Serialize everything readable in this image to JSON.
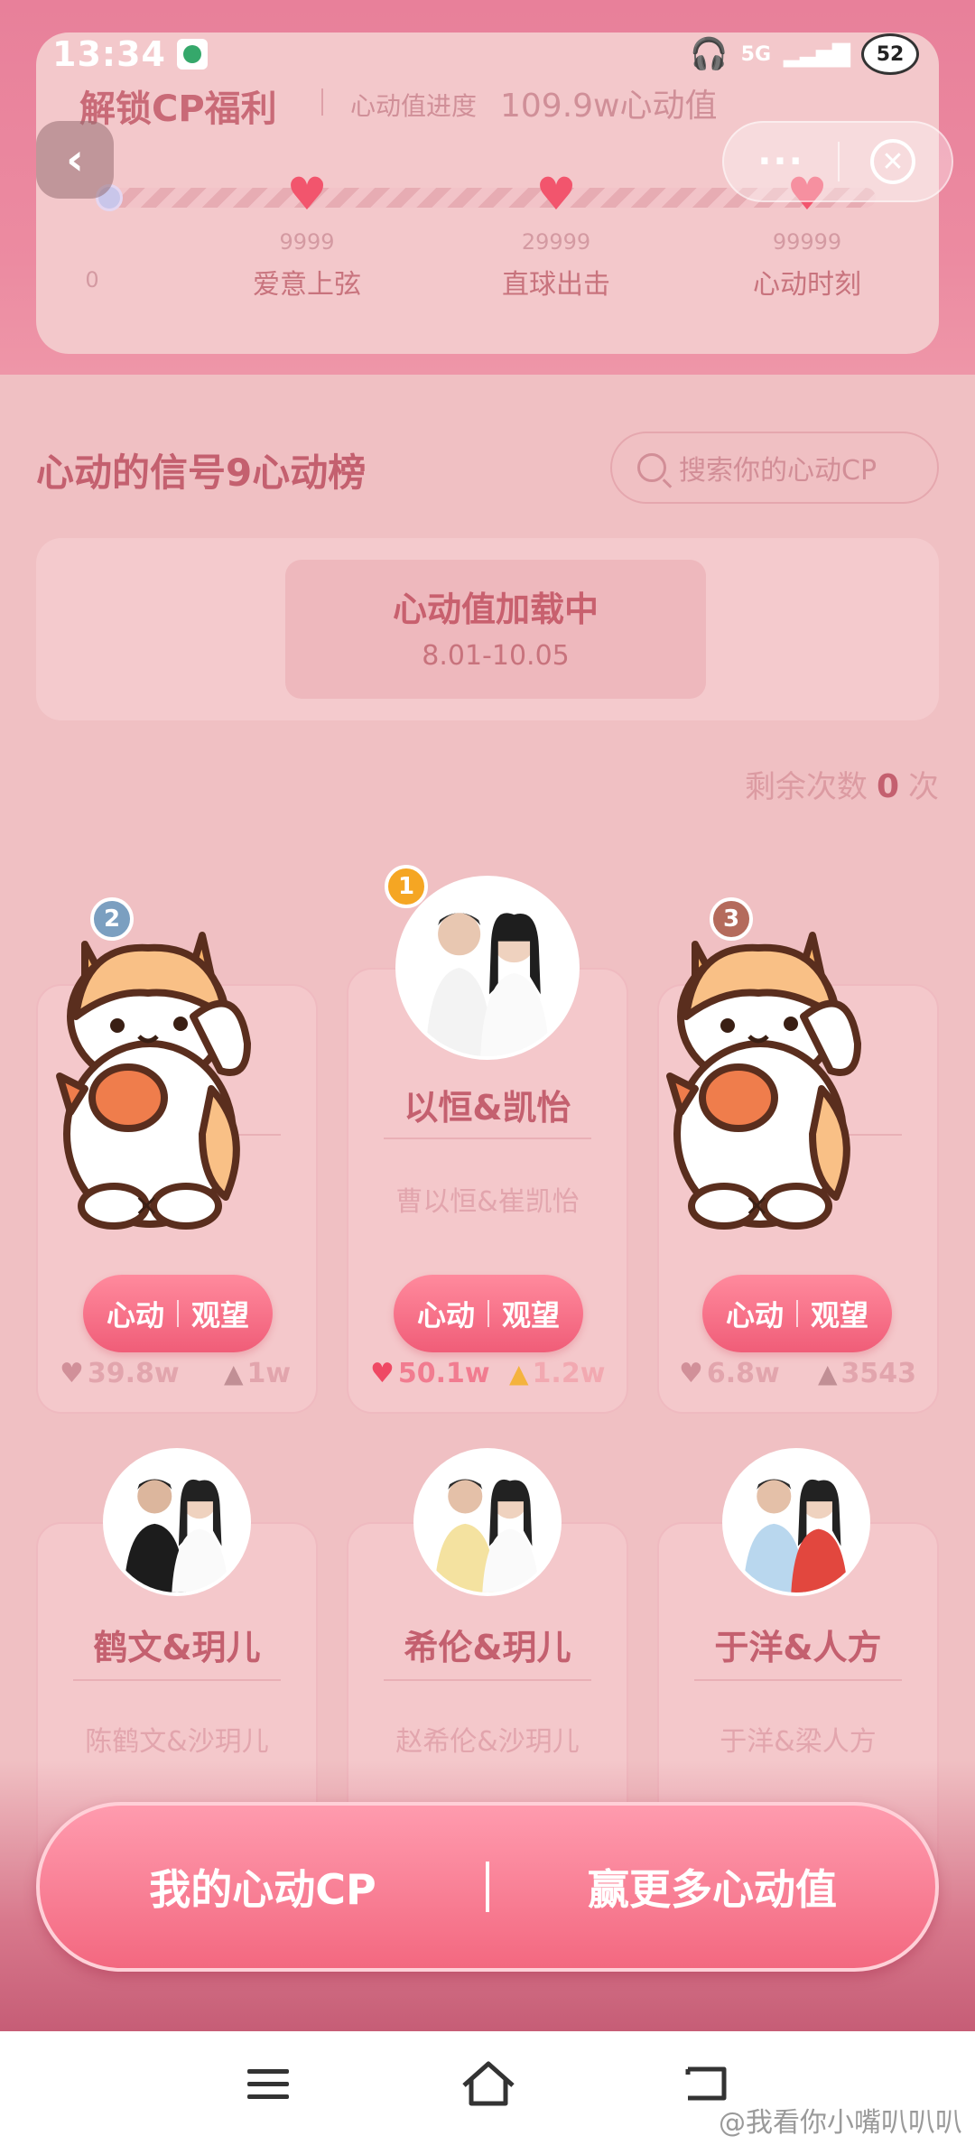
{
  "status_bar": {
    "time": "13:34",
    "network": "5G",
    "battery": "52"
  },
  "welfare": {
    "title": "解锁CP福利",
    "progress_label": "心动值进度",
    "progress_value": "109.9w心动值",
    "milestones": [
      {
        "value": "0",
        "name": ""
      },
      {
        "value": "9999",
        "name": "爱意上弦"
      },
      {
        "value": "29999",
        "name": "直球出击"
      },
      {
        "value": "99999",
        "name": "心动时刻"
      }
    ]
  },
  "nav": {
    "back_icon": "chevron-left-icon",
    "more_label": "···",
    "close_icon": "close-icon"
  },
  "ranking": {
    "title": "心动的信号9心动榜",
    "search_placeholder": "搜索你的心动CP",
    "loading_title": "心动值加载中",
    "loading_date": "8.01-10.05",
    "remaining_prefix": "剩余次数",
    "remaining_count": "0",
    "remaining_suffix": "次"
  },
  "cards": [
    {
      "rank": "2",
      "name": "",
      "sub": "",
      "action_a": "心动",
      "action_b": "观望",
      "likes": "39.8w",
      "heat": "1w",
      "covered": true
    },
    {
      "rank": "1",
      "name": "以恒&凯怡",
      "sub": "曹以恒&崔凯怡",
      "action_a": "心动",
      "action_b": "观望",
      "likes": "50.1w",
      "heat": "1.2w",
      "covered": false
    },
    {
      "rank": "3",
      "name": "",
      "sub": "",
      "action_a": "心动",
      "action_b": "观望",
      "likes": "6.8w",
      "heat": "3543",
      "covered": true
    },
    {
      "rank": "",
      "name": "鹤文&玥儿",
      "sub": "陈鹤文&沙玥儿"
    },
    {
      "rank": "",
      "name": "希伦&玥儿",
      "sub": "赵希伦&沙玥儿"
    },
    {
      "rank": "",
      "name": "于洋&人方",
      "sub": "于洋&梁人方"
    }
  ],
  "cta": {
    "left": "我的心动CP",
    "right": "赢更多心动值"
  },
  "watermark": "@我看你小嘴叭叭叭",
  "colors": {
    "accent": "#f05d78",
    "panel": "#f0c0c3",
    "title": "#c4606f"
  }
}
